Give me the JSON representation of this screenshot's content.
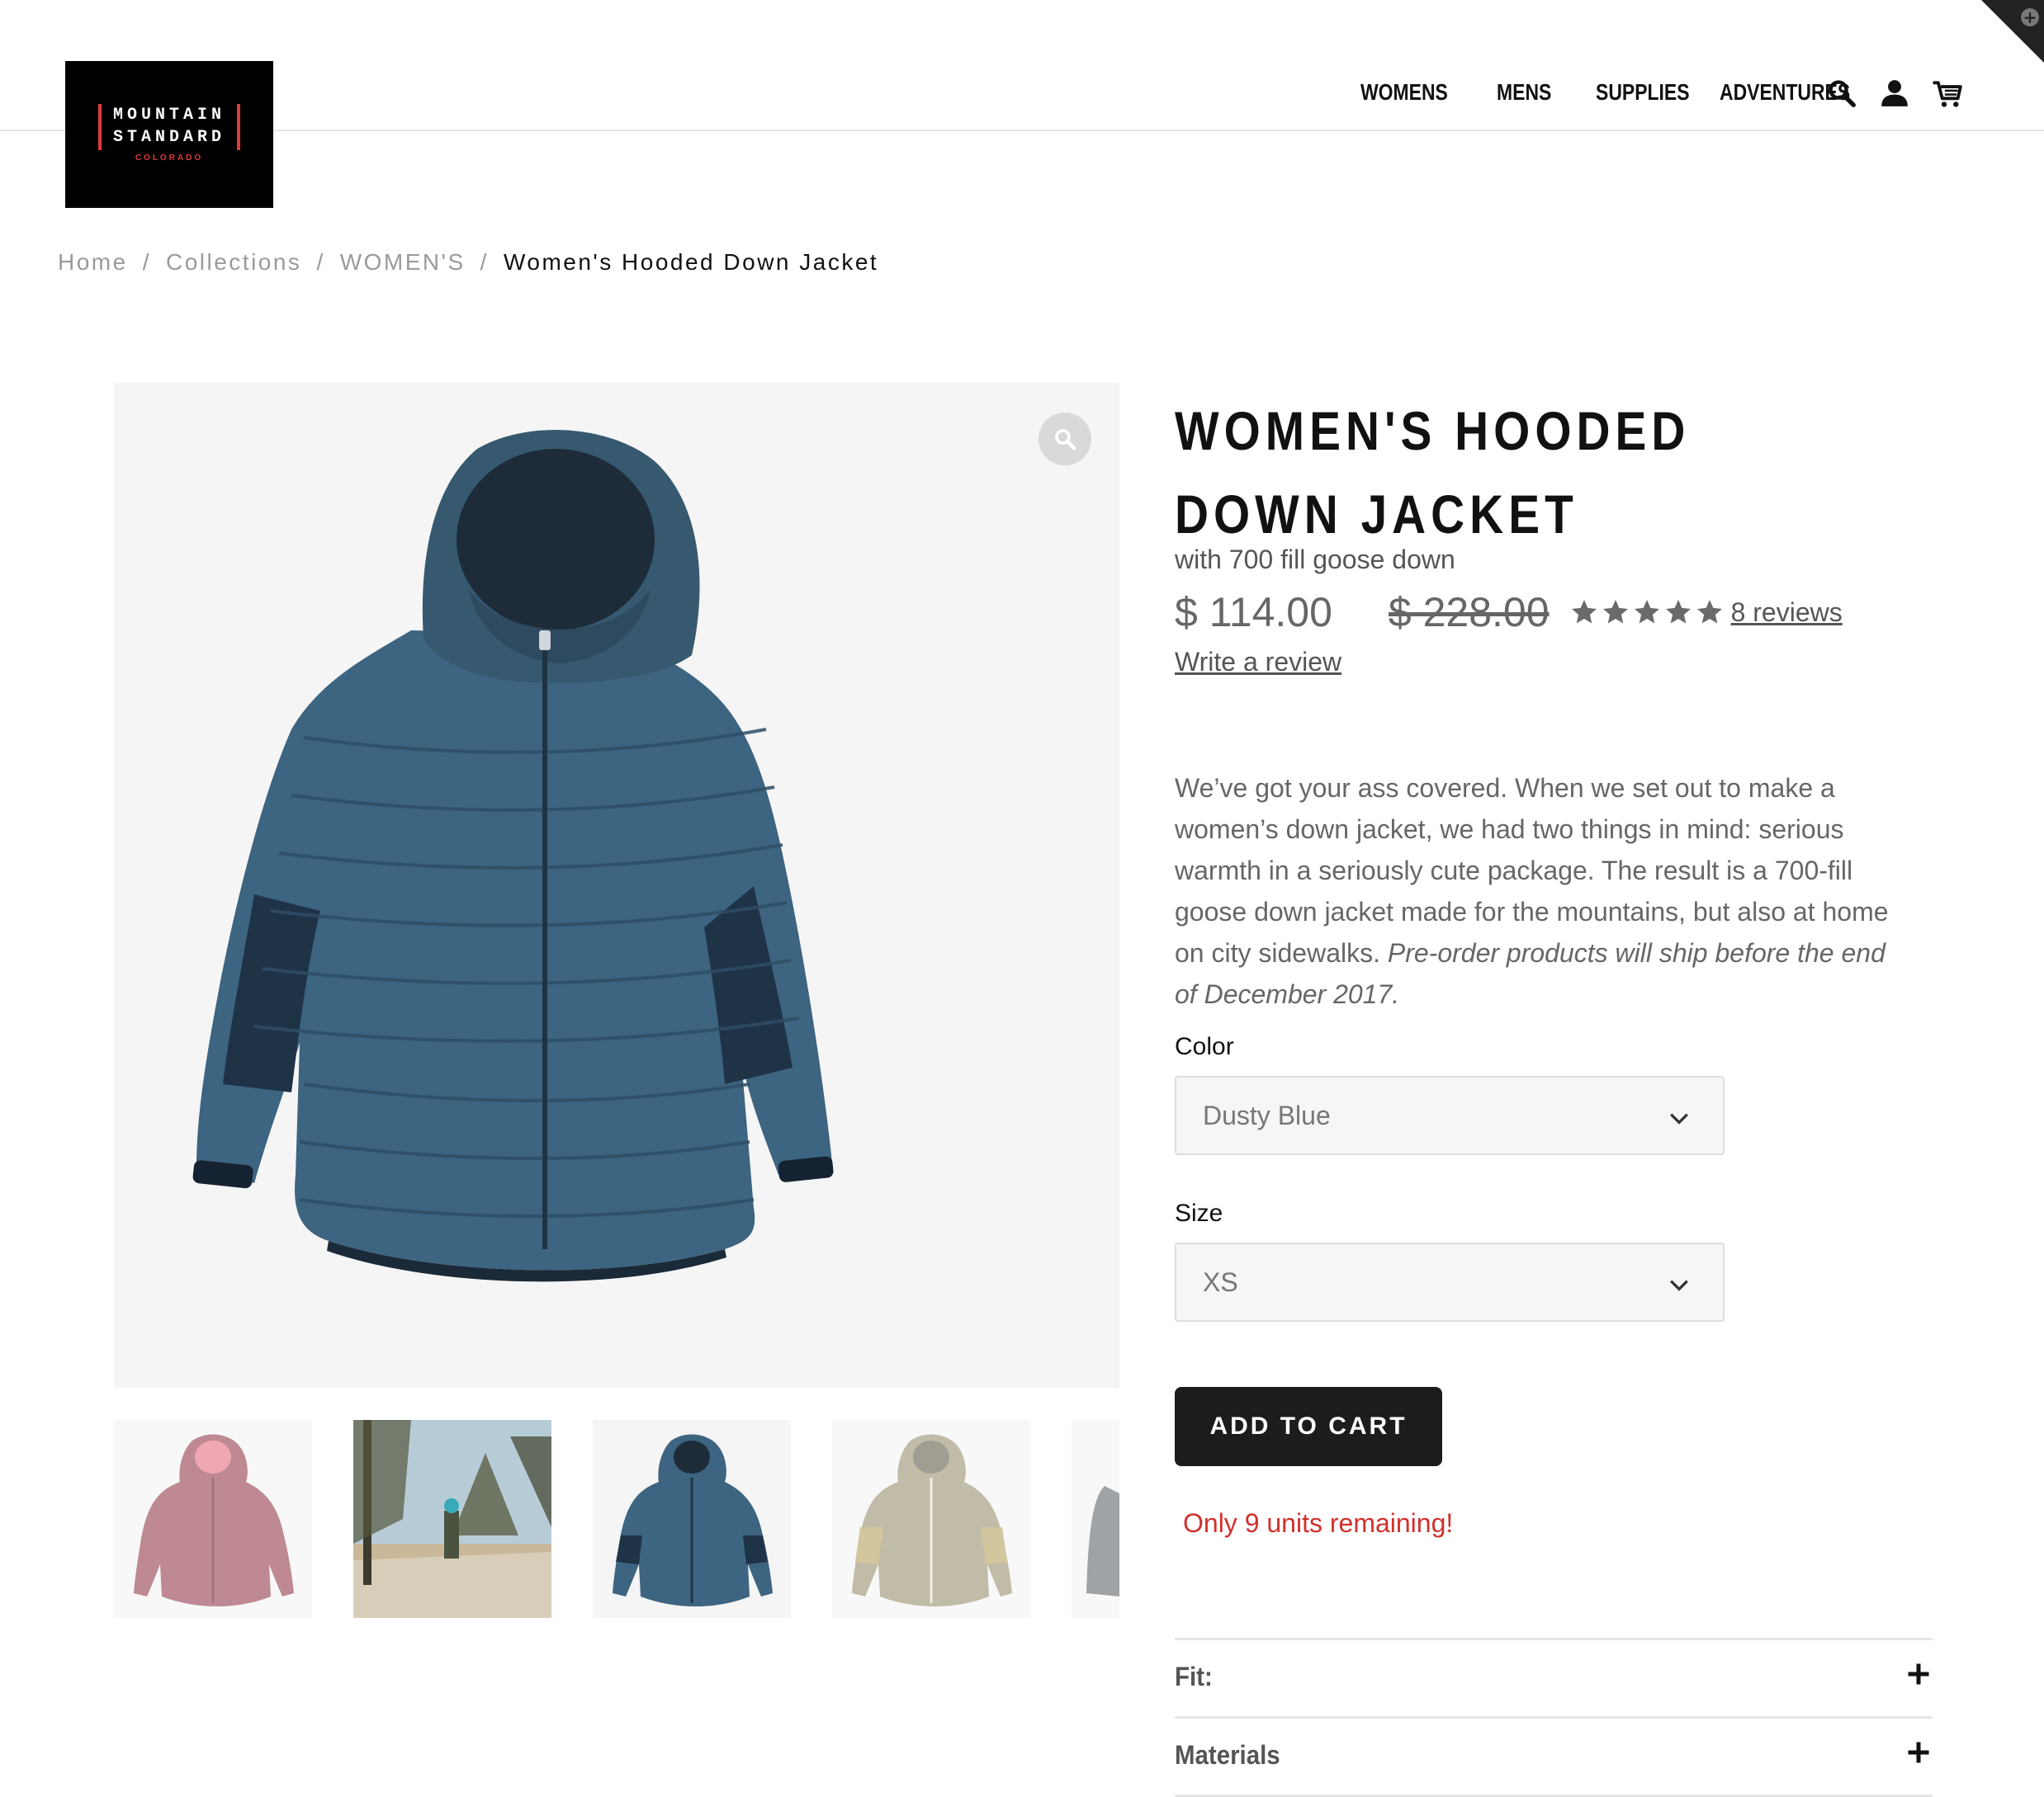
{
  "brand": {
    "logo_line1": "MOUNTAIN",
    "logo_line2": "STANDARD",
    "logo_sub": "COLORADO",
    "accent_color": "#e03a3a"
  },
  "nav": {
    "items": [
      "WOMENS",
      "MENS",
      "SUPPLIES",
      "ADVENTURES"
    ],
    "icons": [
      "search-icon",
      "account-icon",
      "cart-icon"
    ]
  },
  "breadcrumb": {
    "items": [
      "Home",
      "Collections",
      "WOMEN'S"
    ],
    "separator": "/",
    "current": "Women's Hooded Down Jacket"
  },
  "product": {
    "title": "WOMEN'S HOODED DOWN JACKET",
    "subtitle": "with 700 fill goose down",
    "price": "$ 114.00",
    "compare_price": "$ 228.00",
    "rating": 5,
    "reviews_link": "8 reviews",
    "write_review": "Write a review",
    "description": "We’ve got your ass covered. When we set out to make a women’s down jacket, we had two things in mind: serious warmth in a seriously cute package. The result is a 700-fill goose down jacket made for the mountains, but also at home on city sidewalks.",
    "description_note": "Pre-order products will ship before the end of December 2017.",
    "color_label": "Color",
    "color_value": "Dusty Blue",
    "size_label": "Size",
    "size_value": "XS",
    "add_to_cart": "ADD TO CART",
    "stock_note": "Only 9 units remaining!",
    "stock_color": "#d0312d",
    "accordion": [
      "Fit:",
      "Materials"
    ]
  },
  "gallery": {
    "thumbnails": [
      "maroon-jacket",
      "snowy-forest-photo",
      "dusty-blue-jacket",
      "tan-jacket",
      "grey-jacket"
    ],
    "main_color": "#3d6480"
  }
}
